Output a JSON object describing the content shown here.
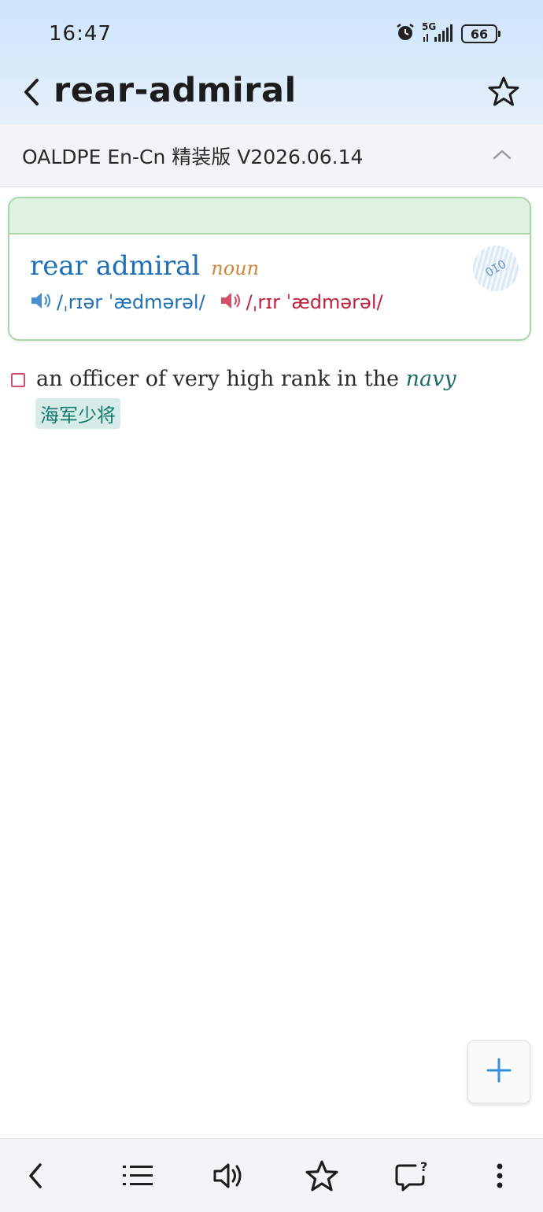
{
  "status_bar": {
    "time": "16:47",
    "network": "5G",
    "battery": "66",
    "icons": [
      "alarm-icon",
      "signal-icon",
      "battery-icon"
    ]
  },
  "header": {
    "title": "rear-admiral",
    "back_icon": "chevron-left-icon",
    "favorite_icon": "star-outline-icon"
  },
  "dictionary": {
    "name": "OALDPE En-Cn 精装版 V2026.06.14",
    "collapse_icon": "chevron-up-icon"
  },
  "entry": {
    "headword": "rear admiral",
    "pos": "noun",
    "badge_text": "OIO",
    "pronunciations": [
      {
        "region": "uk",
        "ipa": "/ˌrɪər ˈædmərəl/",
        "icon": "speaker-icon",
        "color": "#1f6fb5"
      },
      {
        "region": "us",
        "ipa": "/ˌrɪr ˈædmərəl/",
        "icon": "speaker-icon",
        "color": "#c0213b"
      }
    ]
  },
  "sense": {
    "definition": "an officer of very high rank in the",
    "xref": "navy",
    "translation": "海军少将"
  },
  "fab": {
    "icon": "plus-icon"
  },
  "toolbar": {
    "items": [
      "back-icon",
      "list-icon",
      "speaker-icon",
      "star-icon",
      "question-bubble-icon",
      "more-vertical-icon"
    ]
  },
  "colors": {
    "accent_blue": "#1f6fb5",
    "accent_red": "#c0213b",
    "card_green_border": "#a9d6a9",
    "translation_bg": "#d7ece8"
  }
}
